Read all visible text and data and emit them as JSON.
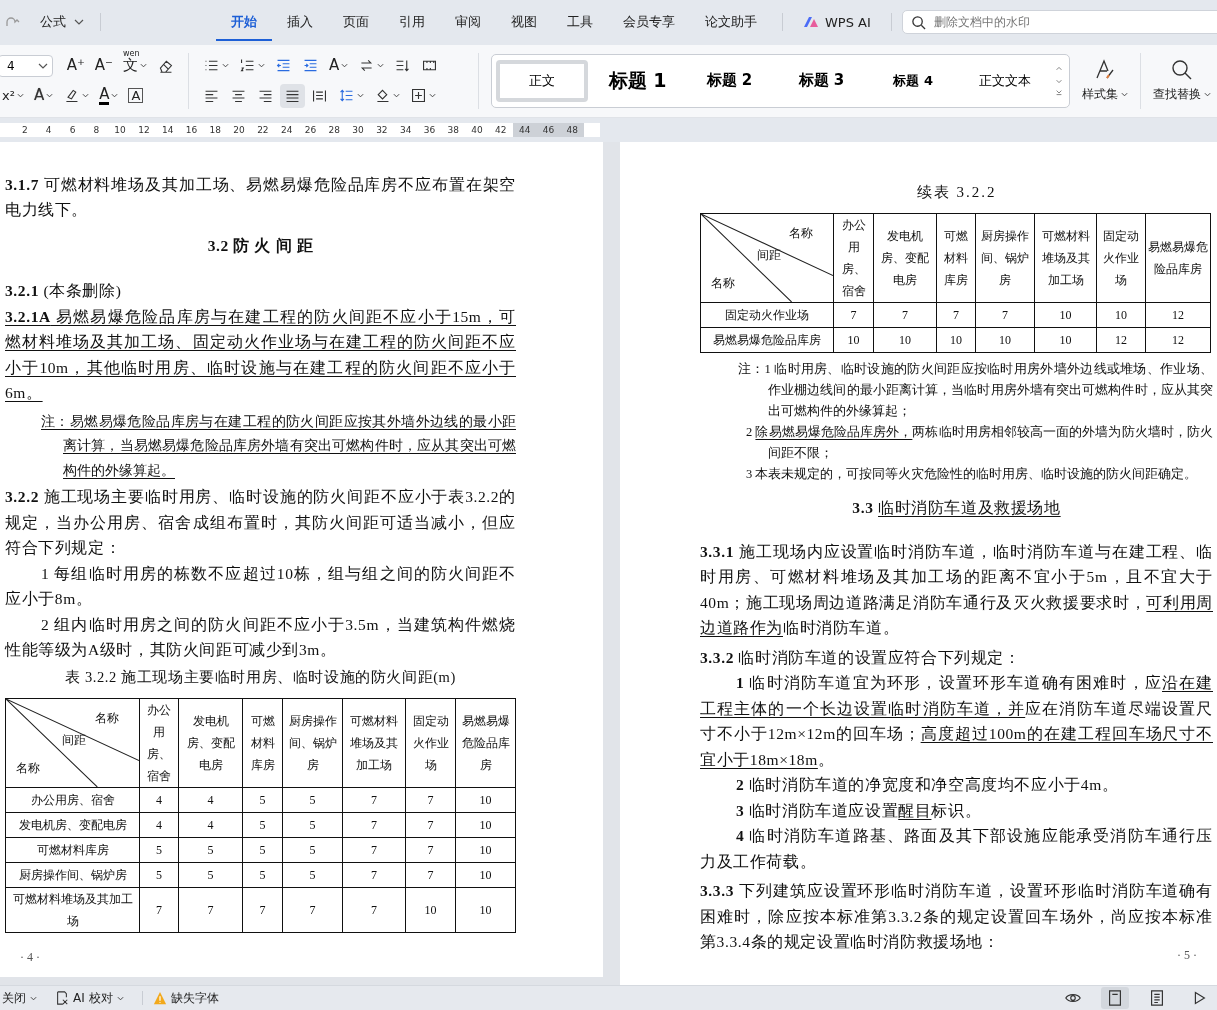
{
  "title_bar": {
    "quick_access": "公式",
    "tabs": [
      {
        "label": "开始",
        "selected": true
      },
      {
        "label": "插入",
        "selected": false
      },
      {
        "label": "页面",
        "selected": false
      },
      {
        "label": "引用",
        "selected": false
      },
      {
        "label": "审阅",
        "selected": false
      },
      {
        "label": "视图",
        "selected": false
      },
      {
        "label": "工具",
        "selected": false
      },
      {
        "label": "会员专享",
        "selected": false
      },
      {
        "label": "论文助手",
        "selected": false
      }
    ],
    "ai_button": "WPS AI",
    "search": {
      "placeholder": "删除文档中的水印"
    }
  },
  "ribbon": {
    "font_size": "4",
    "font_row1": [
      {
        "kind": "grow-font",
        "glyph": "A⁺",
        "dropdown": false,
        "selected": false
      },
      {
        "kind": "shrink-font",
        "glyph": "A⁻",
        "dropdown": false,
        "selected": false
      },
      {
        "kind": "phonetic",
        "glyph": "文",
        "ruby": "wen",
        "dropdown": true,
        "selected": false
      },
      {
        "kind": "eraser",
        "dropdown": false,
        "selected": false
      }
    ],
    "font_row2": [
      {
        "kind": "superscript",
        "glyph": "x²",
        "dropdown": true,
        "selected": false
      },
      {
        "kind": "text-effect",
        "glyph": "A",
        "dropdown": true,
        "selected": false
      },
      {
        "kind": "highlight",
        "dropdown": true,
        "selected": false
      },
      {
        "kind": "font-color",
        "glyph": "A",
        "dropdown": true,
        "selected": false
      },
      {
        "kind": "char-border",
        "glyph": "A",
        "dropdown": false,
        "selected": false
      }
    ],
    "para_row1": [
      {
        "kind": "bullets",
        "dropdown": true,
        "selected": false
      },
      {
        "kind": "numbering",
        "dropdown": true,
        "selected": false
      },
      {
        "kind": "outdent",
        "dropdown": false,
        "selected": false
      },
      {
        "kind": "indent",
        "dropdown": false,
        "selected": false
      },
      {
        "kind": "char-spacing",
        "glyph": "A",
        "dropdown": true,
        "selected": false
      },
      {
        "kind": "swap",
        "dropdown": true,
        "selected": false
      },
      {
        "kind": "sort",
        "dropdown": false,
        "selected": false
      },
      {
        "kind": "grid",
        "dropdown": false,
        "selected": false
      }
    ],
    "para_row2": [
      {
        "kind": "align-left",
        "dropdown": false,
        "selected": false
      },
      {
        "kind": "align-center",
        "dropdown": false,
        "selected": false
      },
      {
        "kind": "align-right",
        "dropdown": false,
        "selected": false
      },
      {
        "kind": "align-justify",
        "dropdown": false,
        "selected": true
      },
      {
        "kind": "distribute",
        "dropdown": false,
        "selected": false
      },
      {
        "kind": "line-spacing",
        "dropdown": true,
        "selected": false
      },
      {
        "kind": "shading",
        "dropdown": true,
        "selected": false
      },
      {
        "kind": "borders",
        "dropdown": true,
        "selected": false
      }
    ],
    "styles": [
      {
        "label": "正文",
        "kind": "body",
        "selected": true
      },
      {
        "label": "标题 1",
        "kind": "h1",
        "selected": false
      },
      {
        "label": "标题 2",
        "kind": "h2",
        "selected": false
      },
      {
        "label": "标题 3",
        "kind": "h3",
        "selected": false
      },
      {
        "label": "标题 4",
        "kind": "h4",
        "selected": false
      },
      {
        "label": "正文文本",
        "kind": "body",
        "selected": false
      }
    ],
    "style_set": "样式集",
    "find_replace": "查找替换"
  },
  "ruler": {
    "ticks": [
      {
        "label": "2",
        "margin": false
      },
      {
        "label": "4",
        "margin": false
      },
      {
        "label": "6",
        "margin": false
      },
      {
        "label": "8",
        "margin": false
      },
      {
        "label": "10",
        "margin": false
      },
      {
        "label": "12",
        "margin": false
      },
      {
        "label": "14",
        "margin": false
      },
      {
        "label": "16",
        "margin": false
      },
      {
        "label": "18",
        "margin": false
      },
      {
        "label": "20",
        "margin": false
      },
      {
        "label": "22",
        "margin": false
      },
      {
        "label": "24",
        "margin": false
      },
      {
        "label": "26",
        "margin": false
      },
      {
        "label": "28",
        "margin": false
      },
      {
        "label": "30",
        "margin": false
      },
      {
        "label": "32",
        "margin": false
      },
      {
        "label": "34",
        "margin": false
      },
      {
        "label": "36",
        "margin": false
      },
      {
        "label": "38",
        "margin": false
      },
      {
        "label": "40",
        "margin": false
      },
      {
        "label": "42",
        "margin": false
      },
      {
        "label": "44",
        "margin": true
      },
      {
        "label": "46",
        "margin": true
      },
      {
        "label": "48",
        "margin": true
      }
    ]
  },
  "left_page": {
    "blocks": [
      {
        "kind": "para",
        "segments": [
          {
            "text": "**3.1.7** 可燃材料堆场及其加工场、易燃易爆危险品库房不应布置在架空电力线下。",
            "underlined": false
          }
        ]
      },
      {
        "kind": "heading",
        "segments": [
          {
            "text": "**3.2 防 火 间 距**",
            "underlined": false
          }
        ]
      },
      {
        "kind": "para",
        "segments": [
          {
            "text": "**3.2.1** (本条删除)",
            "underlined": false
          }
        ]
      },
      {
        "kind": "para",
        "segments": [
          {
            "text": "**3.2.1A** 易燃易爆危险品库房与在建工程的防火间距不应小于15m，可燃材料堆场及其加工场、固定动火作业场与在建工程的防火间距不应小于10m，其他临时用房、临时设施与在建工程的防火间距不应小于6m。",
            "underlined": true
          }
        ]
      },
      {
        "kind": "note",
        "segments": [
          {
            "text": "注：易燃易爆危险品库房与在建工程的防火间距应按其外墙外边线的最小距离计算，当易燃易爆危险品库房外墙有突出可燃构件时，应从其突出可燃构件的外缘算起。",
            "underlined": true
          }
        ]
      },
      {
        "kind": "para",
        "segments": [
          {
            "text": "**3.2.2** 施工现场主要临时用房、临时设施的防火间距不应小于表3.2.2的规定，当办公用房、宿舍成组布置时，其防火间距可适当减小，但应符合下列规定：",
            "underlined": false
          }
        ]
      },
      {
        "kind": "item",
        "segments": [
          {
            "text": "1 每组临时用房的栋数不应超过10栋，组与组之间的防火间距不应小于8m。",
            "underlined": false
          }
        ]
      },
      {
        "kind": "item",
        "segments": [
          {
            "text": "2 组内临时用房之间的防火间距不应小于3.5m，当建筑构件燃烧性能等级为A级时，其防火间距可减少到3m。",
            "underlined": false
          }
        ]
      },
      {
        "kind": "caption",
        "segments": [
          {
            "text": "表 3.2.2 施工现场主要临时用房、临时设施的防火间距(m)",
            "underlined": false
          }
        ]
      }
    ],
    "table": {
      "corner": {
        "top": "名称",
        "middle": "间距",
        "bottom": "名称"
      },
      "columns": [
        "办公用房、宿舍",
        "发电机房、变配电房",
        "可燃材料库房",
        "厨房操作间、锅炉房",
        "可燃材料堆场及其加工场",
        "固定动火作业场",
        "易燃易爆危险品库房"
      ],
      "rows": [
        {
          "name": "办公用房、宿舍",
          "values": [
            "4",
            "4",
            "5",
            "5",
            "7",
            "7",
            "10"
          ]
        },
        {
          "name": "发电机房、变配电房",
          "values": [
            "4",
            "4",
            "5",
            "5",
            "7",
            "7",
            "10"
          ]
        },
        {
          "name": "可燃材料库房",
          "values": [
            "5",
            "5",
            "5",
            "5",
            "7",
            "7",
            "10"
          ]
        },
        {
          "name": "厨房操作间、锅炉房",
          "values": [
            "5",
            "5",
            "5",
            "5",
            "7",
            "7",
            "10"
          ]
        },
        {
          "name": "可燃材料堆场及其加工场",
          "values": [
            "7",
            "7",
            "7",
            "7",
            "7",
            "10",
            "10"
          ]
        }
      ]
    },
    "page_number": "· 4 ·"
  },
  "right_page": {
    "caption": "续表 3.2.2",
    "table": {
      "corner": {
        "top": "名称",
        "middle": "间距",
        "bottom": "名称"
      },
      "columns": [
        "办公用房、宿舍",
        "发电机房、变配电房",
        "可燃材料库房",
        "厨房操作间、锅炉房",
        "可燃材料堆场及其加工场",
        "固定动火作业场",
        "易燃易爆危险品库房"
      ],
      "rows": [
        {
          "name": "固定动火作业场",
          "values": [
            "7",
            "7",
            "7",
            "7",
            "10",
            "10",
            "12"
          ]
        },
        {
          "name": "易燃易爆危险品库房",
          "values": [
            "10",
            "10",
            "10",
            "10",
            "10",
            "12",
            "12"
          ]
        }
      ]
    },
    "blocks": [
      {
        "kind": "table-note",
        "segments": [
          {
            "text": "注：1 临时用房、临时设施的防火间距应按临时用房外墙外边线或堆场、作业场、作业棚边线间的最小距离计算，当临时用房外墙有突出可燃构件时，应从其突出可燃构件的外缘算起；",
            "underlined": false
          }
        ]
      },
      {
        "kind": "table-note-item",
        "segments": [
          {
            "text": "2 ",
            "underlined": false
          },
          {
            "text": "除易燃易爆危险品库房外，",
            "underlined": true
          },
          {
            "text": "两栋临时用房相邻较高一面的外墙为防火墙时，防火间距不限；",
            "underlined": false
          }
        ]
      },
      {
        "kind": "table-note-item",
        "segments": [
          {
            "text": "3 本表未规定的，可按同等火灾危险性的临时用房、临时设施的防火间距确定。",
            "underlined": false
          }
        ]
      },
      {
        "kind": "heading",
        "segments": [
          {
            "text": "**3.3** ",
            "underlined": false
          },
          {
            "text": "临时消防车道及救援场地",
            "underlined": true
          }
        ]
      },
      {
        "kind": "para",
        "segments": [
          {
            "text": "**3.3.1** 施工现场内应设置临时消防车道，临时消防车道与在建工程、临时用房、可燃材料堆场及其加工场的距离不宜小于5m，且不宜大于40m；施工现场周边道路满足消防车通行及灭火救援要求时，",
            "underlined": false
          },
          {
            "text": "可利用周边道路作为",
            "underlined": true
          },
          {
            "text": "临时消防车道。",
            "underlined": false
          }
        ]
      },
      {
        "kind": "para",
        "segments": [
          {
            "text": "**3.3.2** 临时消防车道的设置应符合下列规定：",
            "underlined": false
          }
        ]
      },
      {
        "kind": "item",
        "segments": [
          {
            "text": "**1** 临时消防车道宜为环形，设置环形车道确有困难时，应",
            "underlined": false
          },
          {
            "text": "沿在建工程主体的一个长边设置临时消防车道，并",
            "underlined": true
          },
          {
            "text": "应在消防车道尽端设置尺寸不小于12m×12m的回车场；",
            "underlined": false
          },
          {
            "text": "高度超过100m的在建工程回车场尺寸不宜小于18m×18m",
            "underlined": true
          },
          {
            "text": "。",
            "underlined": false
          }
        ]
      },
      {
        "kind": "item",
        "segments": [
          {
            "text": "**2** 临时消防车道的净宽度和净空高度均不应小于4m。",
            "underlined": false
          }
        ]
      },
      {
        "kind": "item",
        "segments": [
          {
            "text": "**3** 临时消防车道应设置",
            "underlined": false
          },
          {
            "text": "醒目",
            "underlined": true
          },
          {
            "text": "标识。",
            "underlined": false
          }
        ]
      },
      {
        "kind": "item",
        "segments": [
          {
            "text": "**4** 临时消防车道路基、路面及其下部设施应能承受消防车通行压力及工作荷载。",
            "underlined": false
          }
        ]
      },
      {
        "kind": "para",
        "segments": [
          {
            "text": "**3.3.3** 下列建筑应设置环形临时消防车道，设置环形临时消防车道确有困难时，除应按本标准第3.3.2条的规定设置回车场外，尚应按本标准第3.3.4条的规定设置临时消防救援场地：",
            "underlined": false
          }
        ]
      }
    ],
    "page_number": "· 5 ·"
  },
  "status_bar": {
    "close": "关闭",
    "proofread": "AI 校对",
    "missing_fonts": "缺失字体",
    "views": [
      {
        "kind": "read",
        "selected": false
      },
      {
        "kind": "page",
        "selected": true
      },
      {
        "kind": "outline",
        "selected": false
      },
      {
        "kind": "play",
        "selected": false
      }
    ]
  }
}
